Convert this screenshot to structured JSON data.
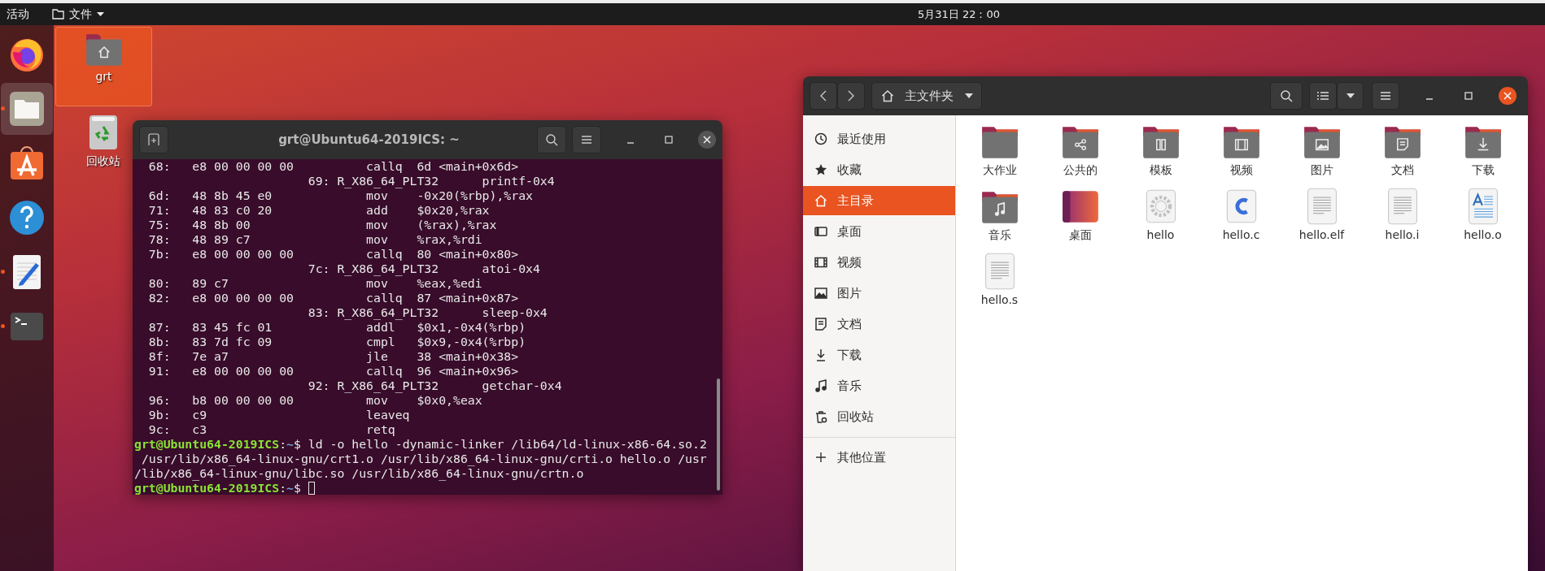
{
  "top_bar": {
    "activities": "活动",
    "app_menu": "文件",
    "clock": "5月31日 22：00"
  },
  "dock": [
    {
      "kind": "firefox",
      "selected": false,
      "running": false
    },
    {
      "kind": "files",
      "selected": true,
      "running": true
    },
    {
      "kind": "software",
      "selected": false,
      "running": false
    },
    {
      "kind": "help",
      "selected": false,
      "running": false
    },
    {
      "kind": "text-editor",
      "selected": false,
      "running": true
    },
    {
      "kind": "terminal",
      "selected": false,
      "running": true
    }
  ],
  "desktop_icons": [
    {
      "label": "grt",
      "kind": "home",
      "selected": true
    },
    {
      "label": "回收站",
      "kind": "trash",
      "selected": false
    }
  ],
  "terminal": {
    "title": "grt@Ubuntu64-2019ICS: ~",
    "lines": [
      {
        "kind": "output",
        "text": "  68:   e8 00 00 00 00          callq  6d <main+0x6d>"
      },
      {
        "kind": "output",
        "text": "                        69: R_X86_64_PLT32      printf-0x4"
      },
      {
        "kind": "output",
        "text": "  6d:   48 8b 45 e0             mov    -0x20(%rbp),%rax"
      },
      {
        "kind": "output",
        "text": "  71:   48 83 c0 20             add    $0x20,%rax"
      },
      {
        "kind": "output",
        "text": "  75:   48 8b 00                mov    (%rax),%rax"
      },
      {
        "kind": "output",
        "text": "  78:   48 89 c7                mov    %rax,%rdi"
      },
      {
        "kind": "output",
        "text": "  7b:   e8 00 00 00 00          callq  80 <main+0x80>"
      },
      {
        "kind": "output",
        "text": "                        7c: R_X86_64_PLT32      atoi-0x4"
      },
      {
        "kind": "output",
        "text": "  80:   89 c7                   mov    %eax,%edi"
      },
      {
        "kind": "output",
        "text": "  82:   e8 00 00 00 00          callq  87 <main+0x87>"
      },
      {
        "kind": "output",
        "text": "                        83: R_X86_64_PLT32      sleep-0x4"
      },
      {
        "kind": "output",
        "text": "  87:   83 45 fc 01             addl   $0x1,-0x4(%rbp)"
      },
      {
        "kind": "output",
        "text": "  8b:   83 7d fc 09             cmpl   $0x9,-0x4(%rbp)"
      },
      {
        "kind": "output",
        "text": "  8f:   7e a7                   jle    38 <main+0x38>"
      },
      {
        "kind": "output",
        "text": "  91:   e8 00 00 00 00          callq  96 <main+0x96>"
      },
      {
        "kind": "output",
        "text": "                        92: R_X86_64_PLT32      getchar-0x4"
      },
      {
        "kind": "output",
        "text": "  96:   b8 00 00 00 00          mov    $0x0,%eax"
      },
      {
        "kind": "output",
        "text": "  9b:   c9                      leaveq"
      },
      {
        "kind": "output",
        "text": "  9c:   c3                      retq"
      },
      {
        "kind": "prompt",
        "user": "grt@Ubuntu64-2019ICS",
        "sep": ":",
        "dir": "~",
        "symbol": "$",
        "command": "ld -o hello -dynamic-linker /lib64/ld-linux-x86-64.so.2"
      },
      {
        "kind": "output",
        "text": " /usr/lib/x86_64-linux-gnu/crt1.o /usr/lib/x86_64-linux-gnu/crti.o hello.o /usr"
      },
      {
        "kind": "output",
        "text": "/lib/x86_64-linux-gnu/libc.so /usr/lib/x86_64-linux-gnu/crtn.o"
      },
      {
        "kind": "prompt",
        "user": "grt@Ubuntu64-2019ICS",
        "sep": ":",
        "dir": "~",
        "symbol": "$",
        "cursor": true
      }
    ]
  },
  "file_manager": {
    "path": "主文件夹",
    "sidebar": [
      {
        "label": "最近使用",
        "selected": false
      },
      {
        "label": "收藏",
        "selected": false
      },
      {
        "label": "主目录",
        "selected": true
      },
      {
        "label": "桌面",
        "selected": false
      },
      {
        "label": "视频",
        "selected": false
      },
      {
        "label": "图片",
        "selected": false
      },
      {
        "label": "文档",
        "selected": false
      },
      {
        "label": "下载",
        "selected": false
      },
      {
        "label": "音乐",
        "selected": false
      },
      {
        "label": "回收站",
        "selected": false
      }
    ],
    "other_locations": "其他位置",
    "items": [
      {
        "label": "大作业",
        "kind": "folder"
      },
      {
        "label": "公共的",
        "kind": "folder"
      },
      {
        "label": "模板",
        "kind": "folder"
      },
      {
        "label": "视频",
        "kind": "folder"
      },
      {
        "label": "图片",
        "kind": "folder"
      },
      {
        "label": "文档",
        "kind": "folder"
      },
      {
        "label": "下载",
        "kind": "folder"
      },
      {
        "label": "音乐",
        "kind": "folder"
      },
      {
        "label": "桌面",
        "kind": "desktop"
      },
      {
        "label": "hello",
        "kind": "executable"
      },
      {
        "label": "hello.c",
        "kind": "c-source"
      },
      {
        "label": "hello.elf",
        "kind": "text"
      },
      {
        "label": "hello.i",
        "kind": "text"
      },
      {
        "label": "hello.o",
        "kind": "rich-text"
      },
      {
        "label": "hello.s",
        "kind": "text"
      }
    ]
  }
}
